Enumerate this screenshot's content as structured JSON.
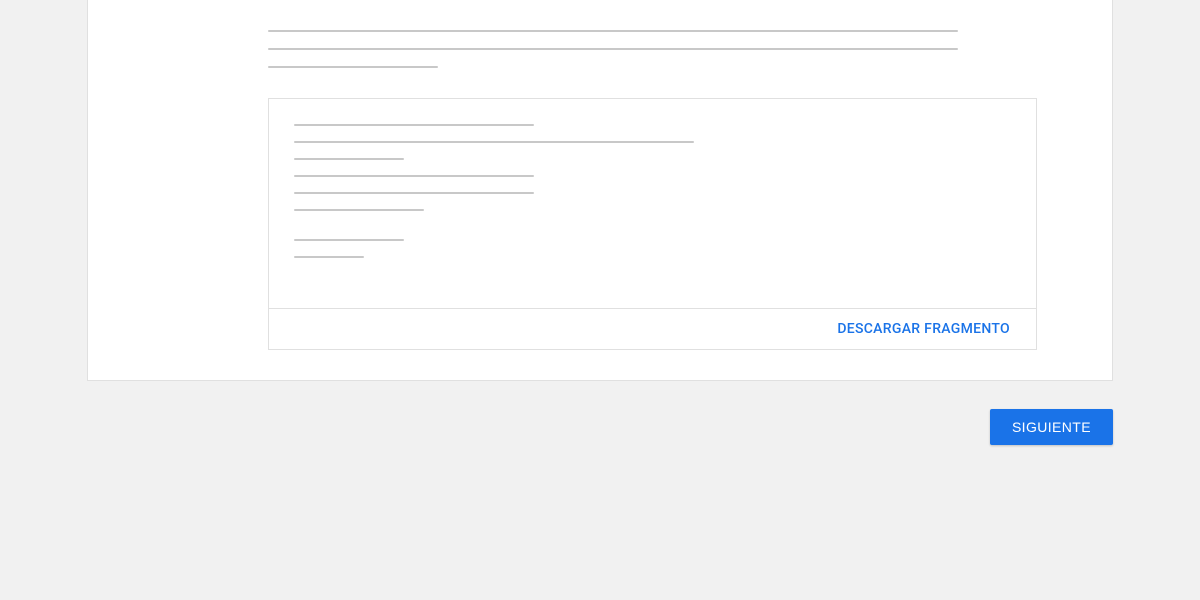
{
  "card": {
    "download_label": "DESCARGAR FRAGMENTO"
  },
  "actions": {
    "next_label": "SIGUIENTE"
  }
}
